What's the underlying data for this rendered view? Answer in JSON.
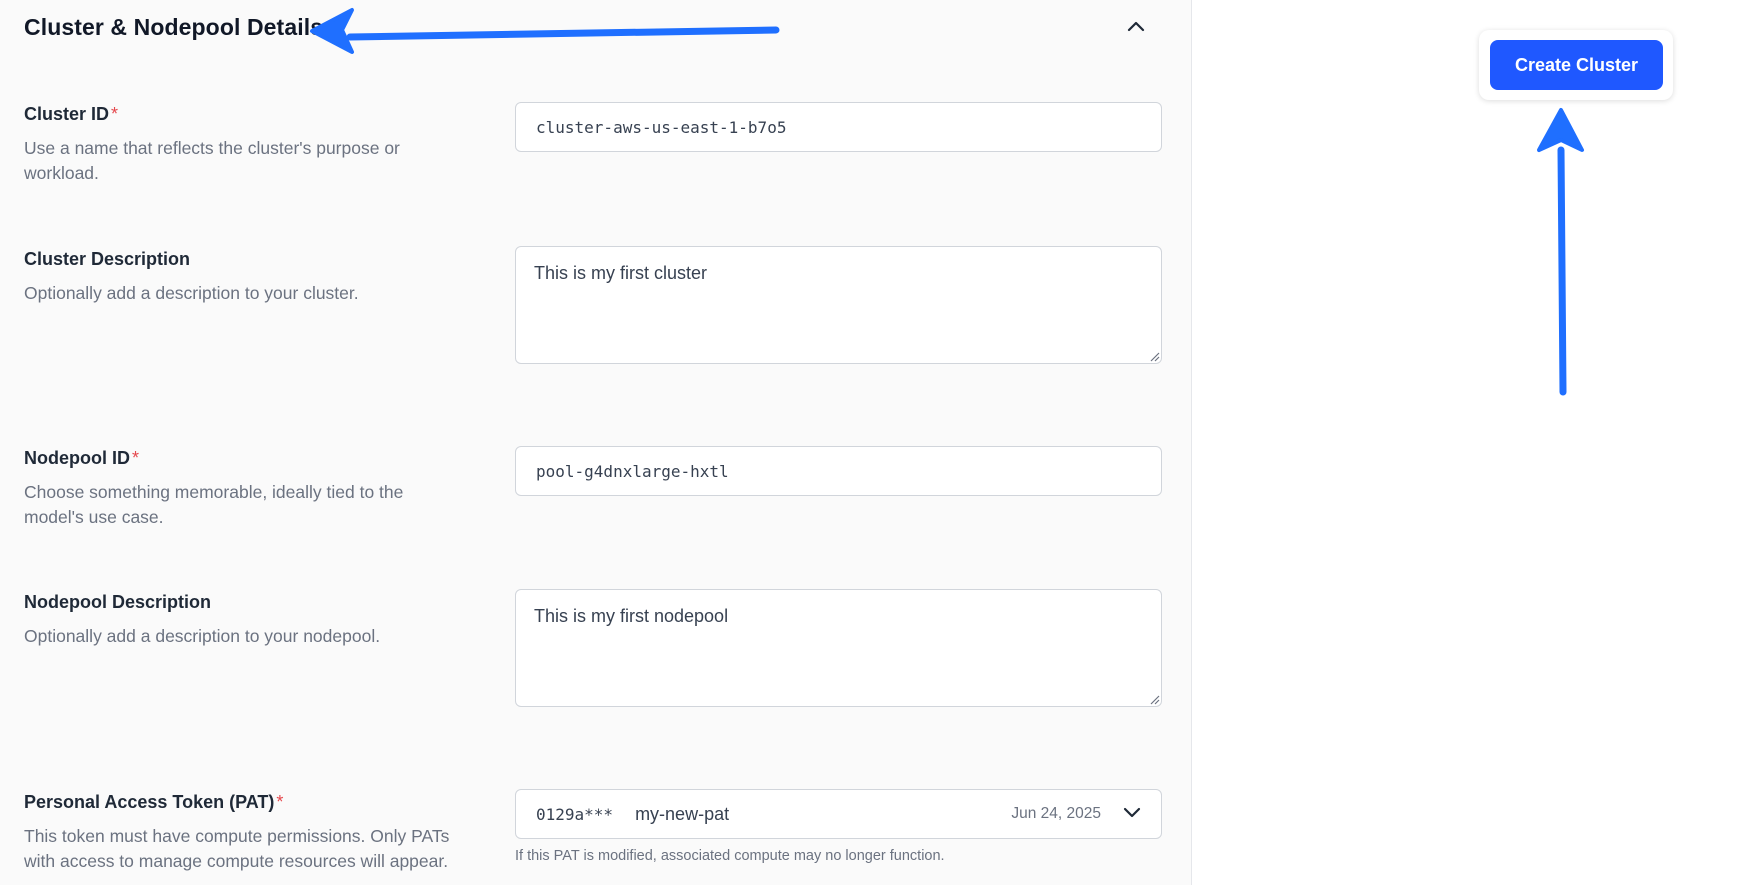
{
  "section": {
    "title": "Cluster & Nodepool Details"
  },
  "fields": {
    "cluster_id": {
      "label": "Cluster ID",
      "required_mark": "*",
      "help": "Use a name that reflects the cluster's purpose or workload.",
      "value": "cluster-aws-us-east-1-b7o5"
    },
    "cluster_description": {
      "label": "Cluster Description",
      "help": "Optionally add a description to your cluster.",
      "value": "This is my first cluster"
    },
    "nodepool_id": {
      "label": "Nodepool ID",
      "required_mark": "*",
      "help": "Choose something memorable, ideally tied to the model's use case.",
      "value": "pool-g4dnxlarge-hxtl"
    },
    "nodepool_description": {
      "label": "Nodepool Description",
      "help": "Optionally add a description to your nodepool.",
      "value": "This is my first nodepool"
    },
    "pat": {
      "label": "Personal Access Token (PAT)",
      "required_mark": "*",
      "help": "This token must have compute permissions. Only PATs with access to manage compute resources will appear.",
      "selected": {
        "token_id": "0129a***",
        "name": "my-new-pat",
        "date": "Jun 24, 2025"
      },
      "note": "If this PAT is modified, associated compute may no longer function."
    }
  },
  "actions": {
    "create_cluster_label": "Create Cluster"
  },
  "icons": {
    "collapse": "chevron-up-icon",
    "dropdown": "chevron-down-icon"
  },
  "colors": {
    "primary": "#1f58ff",
    "annotation_arrow": "#1f6fff",
    "required": "#e5484d"
  }
}
